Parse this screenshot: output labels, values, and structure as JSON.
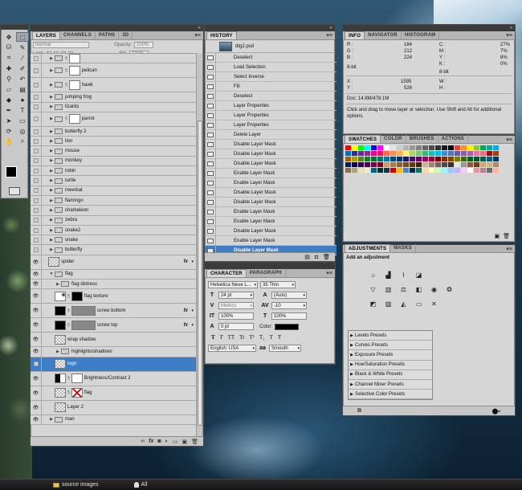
{
  "tools_panel": {
    "tools": [
      "move-icon",
      "marquee-icon",
      "lasso-icon",
      "quick-select-icon",
      "crop-icon",
      "eyedropper-icon",
      "healing-icon",
      "brush-icon",
      "clone-stamp-icon",
      "history-brush-icon",
      "eraser-icon",
      "gradient-icon",
      "blur-icon",
      "dodge-icon",
      "pen-icon",
      "type-icon",
      "path-select-icon",
      "shape-icon",
      "3d-rotate-icon",
      "3d-orbit-icon",
      "hand-icon",
      "zoom-icon"
    ]
  },
  "layers_panel": {
    "tabs": [
      "LAYERS",
      "CHANNELS",
      "PATHS",
      "3D"
    ],
    "blend_mode": "Normal",
    "opacity_label": "Opacity:",
    "opacity_value": "100%",
    "lock_label": "Lock:",
    "fill_label": "Fill:",
    "fill_value": "100%",
    "layers": [
      {
        "name": "",
        "type": "folder-partial"
      },
      {
        "name": "pelican",
        "type": "masked-folder"
      },
      {
        "name": "hawk",
        "type": "masked-folder"
      },
      {
        "name": "jumping frog",
        "type": "folder"
      },
      {
        "name": "lizards",
        "type": "folder"
      },
      {
        "name": "parrot",
        "type": "masked-folder"
      },
      {
        "name": "butterfly 2",
        "type": "folder"
      },
      {
        "name": "lion",
        "type": "folder"
      },
      {
        "name": "mouse",
        "type": "folder"
      },
      {
        "name": "monkey",
        "type": "folder"
      },
      {
        "name": "robin",
        "type": "folder"
      },
      {
        "name": "turtle",
        "type": "folder"
      },
      {
        "name": "meerkat",
        "type": "folder"
      },
      {
        "name": "flamingo",
        "type": "folder"
      },
      {
        "name": "chameleon",
        "type": "folder"
      },
      {
        "name": "zebra",
        "type": "folder"
      },
      {
        "name": "snake2",
        "type": "folder"
      },
      {
        "name": "snake",
        "type": "folder"
      },
      {
        "name": "butterfly",
        "type": "folder"
      },
      {
        "name": "spider",
        "type": "layer-fx"
      },
      {
        "name": "flag",
        "type": "open-folder"
      },
      {
        "name": "flag distress",
        "type": "subfolder"
      },
      {
        "name": "flag texture",
        "type": "masked-layer"
      },
      {
        "name": "screw bottom",
        "type": "layer-fx-black"
      },
      {
        "name": "screw top",
        "type": "layer-fx-black"
      },
      {
        "name": "wrap shadow",
        "type": "layer"
      },
      {
        "name": "highlights/shadows",
        "type": "subfolder"
      },
      {
        "name": "logo",
        "type": "selected-layer"
      },
      {
        "name": "Brightness/Contrast 2",
        "type": "adjustment"
      },
      {
        "name": "flag",
        "type": "flag-layer"
      },
      {
        "name": "Layer 2",
        "type": "layer"
      },
      {
        "name": "man",
        "type": "folder"
      }
    ],
    "footer_icons": [
      "link-icon",
      "fx-icon",
      "mask-icon",
      "adjustment-icon",
      "group-icon",
      "new-layer-icon",
      "trash-icon"
    ],
    "fx_label": "fx"
  },
  "history_panel": {
    "tab": "HISTORY",
    "snapshot": "dtg2.psd",
    "items": [
      "Deselect",
      "Load Selection",
      "Select Inverse",
      "Fill",
      "Deselect",
      "Layer Properties",
      "Layer Properties",
      "Layer Properties",
      "Delete Layer",
      "Disable Layer Mask",
      "Disable Layer Mask",
      "Disable Layer Mask",
      "Enable Layer Mask",
      "Enable Layer Mask",
      "Disable Layer Mask",
      "Disable Layer Mask",
      "Enable Layer Mask",
      "Enable Layer Mask",
      "Disable Layer Mask",
      "Enable Layer Mask",
      "Disable Layer Mask"
    ],
    "selected_index": 20
  },
  "character_panel": {
    "tabs": [
      "CHARACTER",
      "PARAGRAPH"
    ],
    "font_family": "Helvetica Neue L...",
    "font_style": "35 Thin",
    "font_size": "24 pt",
    "leading": "(Auto)",
    "kerning": "Metrics",
    "tracking": "-10",
    "vertical_scale": "100%",
    "horizontal_scale": "100%",
    "baseline_shift": "0 pt",
    "color_label": "Color:",
    "style_buttons": [
      "T",
      "T",
      "TT",
      "Tr",
      "T¹",
      "T₁",
      "T",
      "Ŧ"
    ],
    "language": "English: USA",
    "antialias_icon": "aa",
    "antialias": "Smooth"
  },
  "info_panel": {
    "tabs": [
      "INFO",
      "NAVIGATOR",
      "HISTOGRAM"
    ],
    "r_label": "R :",
    "r_value": "184",
    "g_label": "G :",
    "g_value": "212",
    "b_label": "B :",
    "b_value": "224",
    "bit_left": "8-bit",
    "c_label": "C :",
    "c_value": "27%",
    "m_label": "M :",
    "m_value": "7%",
    "y_label": "Y :",
    "y_value": "8%",
    "k_label": "K :",
    "k_value": "0%",
    "bit_right": "8-bit",
    "x_label": "X :",
    "x_value": "1595",
    "yc_label": "Y :",
    "yc_value": "526",
    "w_label": "W :",
    "h_label": "H :",
    "doc_size": "Doc: 14.8M/478.1M",
    "hint": "Click and drag to move layer or selection.  Use Shift and Alt for additional options."
  },
  "swatches_panel": {
    "tabs": [
      "SWATCHES",
      "COLOR",
      "BRUSHES",
      "ACTIONS"
    ],
    "colors": [
      "#ff0000",
      "#ffff00",
      "#00ff00",
      "#00ffff",
      "#0000ff",
      "#ff00ff",
      "#ffffff",
      "#e6e6e6",
      "#cccccc",
      "#b3b3b3",
      "#999999",
      "#808080",
      "#666666",
      "#4d4d4d",
      "#333333",
      "#1a1a1a",
      "#000000",
      "#ef4136",
      "#f7941d",
      "#fff200",
      "#8dc63f",
      "#00a651",
      "#00a99d",
      "#00aeef",
      "#0072bc",
      "#2e3192",
      "#662d91",
      "#92278f",
      "#ec008c",
      "#ed145b",
      "#f26c4f",
      "#f68e56",
      "#fbaf5d",
      "#fff568",
      "#acd372",
      "#7cc576",
      "#3bb878",
      "#1abbb4",
      "#00bff3",
      "#438cca",
      "#5574b9",
      "#605ca8",
      "#855fa8",
      "#a763a8",
      "#f06eaa",
      "#f26d7d",
      "#9e0b0f",
      "#a0410d",
      "#a36209",
      "#aba000",
      "#598527",
      "#197b30",
      "#007236",
      "#00746b",
      "#0076a3",
      "#004b80",
      "#003471",
      "#1b1464",
      "#440e62",
      "#630460",
      "#9e005d",
      "#9e0039",
      "#790000",
      "#7b2e00",
      "#7d4900",
      "#827b00",
      "#406618",
      "#005e20",
      "#005826",
      "#005952",
      "#005b7f",
      "#003663",
      "#002157",
      "#0d004c",
      "#32004b",
      "#4b0049",
      "#7b0046",
      "#7a0026",
      "#c69c6d",
      "#a67c52",
      "#8c6239",
      "#754c24",
      "#603913",
      "#42210b",
      "#c7b299",
      "#998675",
      "#736357",
      "#534741",
      "#362f2d",
      "#e6e6e6",
      "#9a9a9a",
      "#8e5b3a",
      "#6c4020",
      "#d4a373",
      "#ccb58a",
      "#b08968",
      "#8f6f4f",
      "#a7a37e",
      "#e6e2af",
      "#efecca",
      "#046380",
      "#002f2f",
      "#1c3144",
      "#d00000",
      "#ffba08",
      "#3f88c5",
      "#032b43",
      "#136f63",
      "#ffd6a5",
      "#fdffb6",
      "#caffbf",
      "#9bf6ff",
      "#a0c4ff",
      "#bdb2ff",
      "#ffc6ff",
      "#fffffc",
      "#e5989b",
      "#b5838d",
      "#6d6875",
      "#ffb4a2"
    ]
  },
  "adjustments_panel": {
    "tabs": [
      "ADJUSTMENTS",
      "MASKS"
    ],
    "title": "Add an adjustment",
    "presets": [
      "Levels Presets",
      "Curves Presets",
      "Exposure Presets",
      "Hue/Saturation Presets",
      "Black & White Presets",
      "Channel Mixer Presets",
      "Selective Color Presets"
    ]
  },
  "taskbar": {
    "item1": "source images",
    "item2": "All"
  }
}
